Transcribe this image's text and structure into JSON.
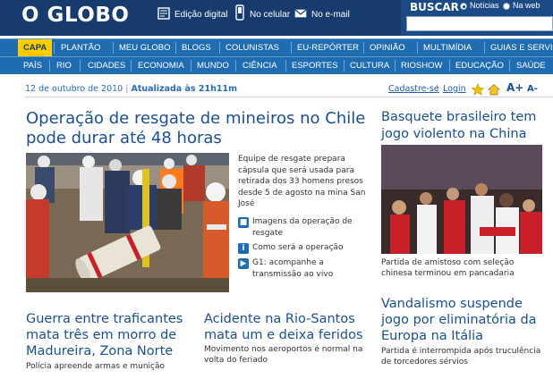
{
  "header": {
    "logo": "O GLOBO",
    "links": [
      "Edição digital",
      "No celular",
      "No e-mail"
    ],
    "search": {
      "label": "BUSCAR",
      "options": [
        "Notícias",
        "Na web"
      ],
      "selected": "Notícias",
      "value": ""
    }
  },
  "nav_primary": [
    "CAPA",
    "PLANTÃO",
    "MEU GLOBO",
    "BLOGS",
    "COLUNISTAS",
    "EU-REPÓRTER",
    "OPINIÃO",
    "MULTIMÍDIA",
    "GUIAS E SERVIÇOS"
  ],
  "nav_primary_active": "CAPA",
  "nav_secondary": [
    "PAÍS",
    "RIO",
    "CIDADES",
    "ECONOMIA",
    "MUNDO",
    "CIÊNCIA",
    "ESPORTES",
    "CULTURA",
    "RIOSHOW",
    "EDUCAÇÃO",
    "SAÚDE"
  ],
  "date_bar": {
    "date": "12 de outubro de 2010",
    "separator": "|",
    "updated": "Atualizada às 21h11m",
    "register": "Cadastre-se",
    "pipe": "|",
    "login": "Login",
    "font_larger": "A+",
    "font_smaller": "A-"
  },
  "main_story": {
    "headline": "Operação de resgate de mineiros no Chile pode durar até 48 horas",
    "lead": "Equipe de resgate prepara cápsula que será usada para retirada dos 33 homens presos desde 5 de agosto na mina San José",
    "related": [
      {
        "icon": "camera-icon",
        "text": "Imagens da operação de resgate"
      },
      {
        "icon": "info-icon",
        "text": "Como será a operação"
      },
      {
        "icon": "play-icon",
        "text": "G1: acompanhe a transmissão ao vivo"
      }
    ]
  },
  "side_story": {
    "headline": "Basquete brasileiro tem jogo violento na China",
    "caption": "Partida de amistoso com seleção chinesa terminou em pancadaria"
  },
  "bottom_stories": [
    {
      "headline": "Guerra entre traficantes mata três em morro de Madureira, Zona Norte",
      "sub": "Polícia apreende armas e munição"
    },
    {
      "headline": "Acidente na Rio-Santos mata um e deixa feridos",
      "sub": "Movimento nos aeroportos é normal na volta do feriado"
    },
    {
      "headline": "Vandalismo suspende jogo por eliminatória da Europa na Itália",
      "sub": "Partida é interrompida após truculência de torcedores sérvios"
    }
  ],
  "colors": {
    "header": "#163b6c",
    "nav": "#1f6cb1",
    "active_tab": "#ffcc00",
    "headline": "#1c4f91"
  }
}
